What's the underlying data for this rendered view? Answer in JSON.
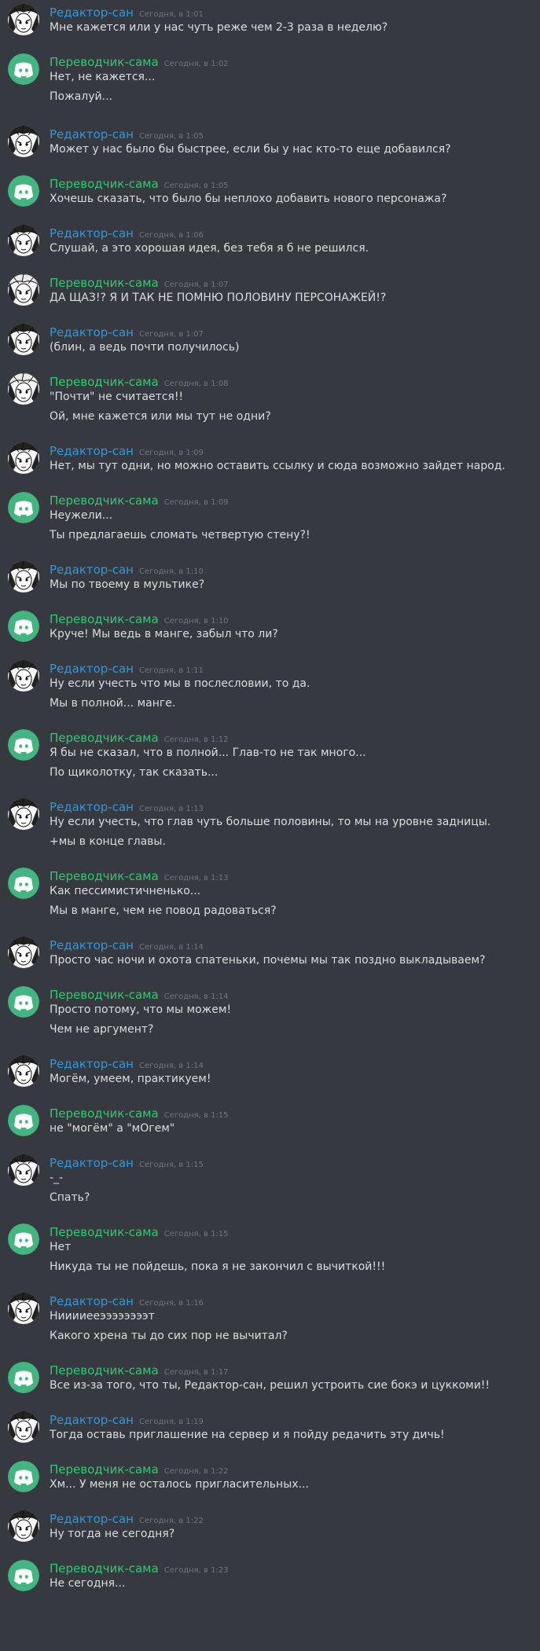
{
  "colors": {
    "background": "#36393f",
    "editor_name": "#3498db",
    "translator_name": "#2ecc71",
    "timestamp": "#72767d",
    "text": "#dcddde",
    "discord_avatar_bg": "#43b581"
  },
  "users": {
    "editor": {
      "name": "Редактор-сан",
      "avatar_icon": "manga-character-avatar-icon"
    },
    "translator": {
      "name": "Переводчик-сама",
      "avatar_icon": "discord-logo-icon"
    },
    "translator_manga": {
      "name": "Переводчик-сама",
      "avatar_icon": "manga-character-avatar-icon"
    }
  },
  "messages": [
    {
      "user": "editor",
      "time": "Сегодня, в 1:01",
      "lines": [
        "Мне кажется или у нас чуть реже чем 2-3 раза в неделю?"
      ]
    },
    {
      "user": "translator",
      "time": "Сегодня, в 1:02",
      "lines": [
        "Нет, не кажется...",
        "Пожалуй..."
      ]
    },
    {
      "user": "editor",
      "time": "Сегодня, в 1:05",
      "lines": [
        "Может у нас было бы быстрее, если бы у нас кто-то еще добавился?"
      ]
    },
    {
      "user": "translator",
      "time": "Сегодня, в 1:05",
      "lines": [
        "Хочешь сказать, что было бы неплохо добавить нового персонажа?"
      ]
    },
    {
      "user": "editor",
      "time": "Сегодня, в 1:06",
      "lines": [
        "Слушай, а это хорошая идея, без тебя я б не решился."
      ]
    },
    {
      "user": "translator_manga",
      "time": "Сегодня, в 1:07",
      "lines": [
        "ДА ЩАЗ!? Я И ТАК НЕ ПОМНЮ ПОЛОВИНУ ПЕРСОНАЖЕЙ!?"
      ]
    },
    {
      "user": "editor",
      "time": "Сегодня, в 1:07",
      "lines": [
        "(блин, а ведь почти получилось)"
      ]
    },
    {
      "user": "translator_manga",
      "time": "Сегодня, в 1:08",
      "lines": [
        "\"Почти\" не считается!!",
        "Ой, мне кажется или мы тут не одни?"
      ]
    },
    {
      "user": "editor",
      "time": "Сегодня, в 1:09",
      "lines": [
        "Нет, мы тут одни, но можно оставить ссылку и сюда возможно зайдет народ."
      ]
    },
    {
      "user": "translator",
      "time": "Сегодня, в 1:09",
      "lines": [
        "Неужели...",
        "Ты предлагаешь сломать четвертую стену?!"
      ]
    },
    {
      "user": "editor",
      "time": "Сегодня, в 1:10",
      "lines": [
        "Мы по твоему в мультике?"
      ]
    },
    {
      "user": "translator",
      "time": "Сегодня, в 1:10",
      "lines": [
        "Круче! Мы ведь в манге, забыл что ли?"
      ]
    },
    {
      "user": "editor",
      "time": "Сегодня, в 1:11",
      "lines": [
        "Ну если учесть что мы в послесловии, то да.",
        "Мы в полной... манге."
      ]
    },
    {
      "user": "translator",
      "time": "Сегодня, в 1:12",
      "lines": [
        "Я бы не сказал, что в полной... Глав-то не так много...",
        "По щиколотку, так сказать..."
      ]
    },
    {
      "user": "editor",
      "time": "Сегодня, в 1:13",
      "lines": [
        "Ну если учесть, что глав чуть больше половины, то мы на уровне задницы.",
        "+мы в конце главы."
      ]
    },
    {
      "user": "translator",
      "time": "Сегодня, в 1:13",
      "lines": [
        "Как пессимистичненько...",
        "Мы в манге, чем не повод радоваться?"
      ]
    },
    {
      "user": "editor",
      "time": "Сегодня, в 1:14",
      "lines": [
        "Просто час ночи и охота спатеньки, почемы мы так поздно выкладываем?"
      ]
    },
    {
      "user": "translator",
      "time": "Сегодня, в 1:14",
      "lines": [
        "Просто потому, что мы можем!",
        "Чем не аргумент?"
      ]
    },
    {
      "user": "editor",
      "time": "Сегодня, в 1:14",
      "lines": [
        "Могём, умеем, практикуем!"
      ]
    },
    {
      "user": "translator",
      "time": "Сегодня, в 1:15",
      "lines": [
        "не \"могём\" а \"мОгем\""
      ]
    },
    {
      "user": "editor",
      "time": "Сегодня, в 1:15",
      "lines": [
        "-_-",
        "Спать?"
      ]
    },
    {
      "user": "translator",
      "time": "Сегодня, в 1:15",
      "lines": [
        "Нет",
        "Никуда ты не пойдешь, пока я не закончил с вычиткой!!!"
      ]
    },
    {
      "user": "editor",
      "time": "Сегодня, в 1:16",
      "lines": [
        "Нииииееээээээээт",
        "Какого хрена ты до сих пор не вычитал?"
      ]
    },
    {
      "user": "translator",
      "time": "Сегодня, в 1:17",
      "lines": [
        "Все из-за того, что ты, Редактор-сан, решил устроить сие бокэ и цуккоми!!"
      ]
    },
    {
      "user": "editor",
      "time": "Сегодня, в 1:19",
      "lines": [
        "Тогда оставь приглашение на сервер и я пойду редачить эту дичь!"
      ]
    },
    {
      "user": "translator",
      "time": "Сегодня, в 1:22",
      "lines": [
        "Хм... У меня не осталось пригласительных..."
      ]
    },
    {
      "user": "editor",
      "time": "Сегодня, в 1:22",
      "lines": [
        "Ну тогда не сегодня?"
      ]
    },
    {
      "user": "translator",
      "time": "Сегодня, в 1:23",
      "lines": [
        "Не сегодня..."
      ]
    }
  ]
}
